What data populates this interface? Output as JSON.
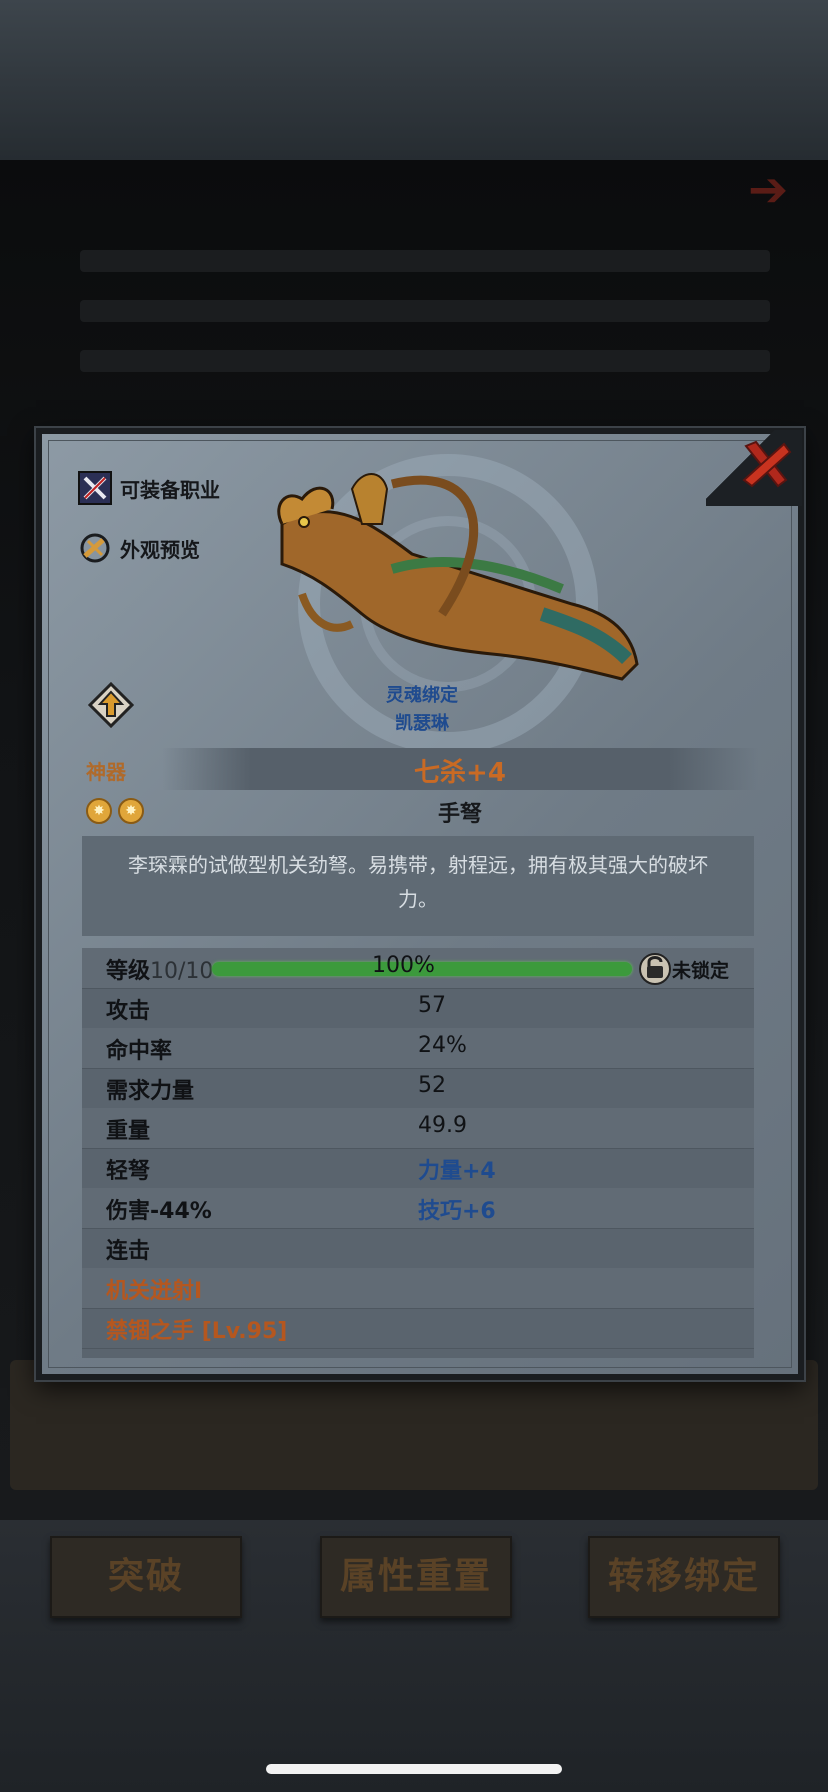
{
  "equip_class_label": "可装备职业",
  "appearance_preview_label": "外观预览",
  "soul_bind": {
    "status": "灵魂绑定",
    "owner": "凯瑟琳"
  },
  "item": {
    "rarity": "神器",
    "name": "七杀+4",
    "type": "手弩",
    "stars": 2,
    "description": "李琛霖的试做型机关劲弩。易携带，射程远，拥有极其强大的破坏力。"
  },
  "level": {
    "label": "等级",
    "value": "10/10",
    "percent": "100%",
    "progress": 1.0,
    "lock_status": "未锁定"
  },
  "stats": [
    {
      "label": "攻击",
      "value": "57"
    },
    {
      "label": "命中率",
      "value": "24%"
    },
    {
      "label": "需求力量",
      "value": "52"
    },
    {
      "label": "重量",
      "value": "49.9"
    },
    {
      "label": "轻弩",
      "value": "力量+4"
    },
    {
      "label": "伤害-44%",
      "value": "技巧+6"
    }
  ],
  "skills": {
    "combo": "连击",
    "mech_shot": "机关迸射I",
    "forbidden_hand": "禁锢之手",
    "forbidden_hand_level": "[Lv.95]"
  },
  "buttons": {
    "breakthrough": "突破",
    "reset_attributes": "属性重置",
    "transfer_binding": "转移绑定"
  },
  "colors": {
    "accent_orange": "#c96a24",
    "bind_blue": "#1f4b8f",
    "progress_green": "#3c9a3c",
    "close_red": "#b0281c"
  }
}
